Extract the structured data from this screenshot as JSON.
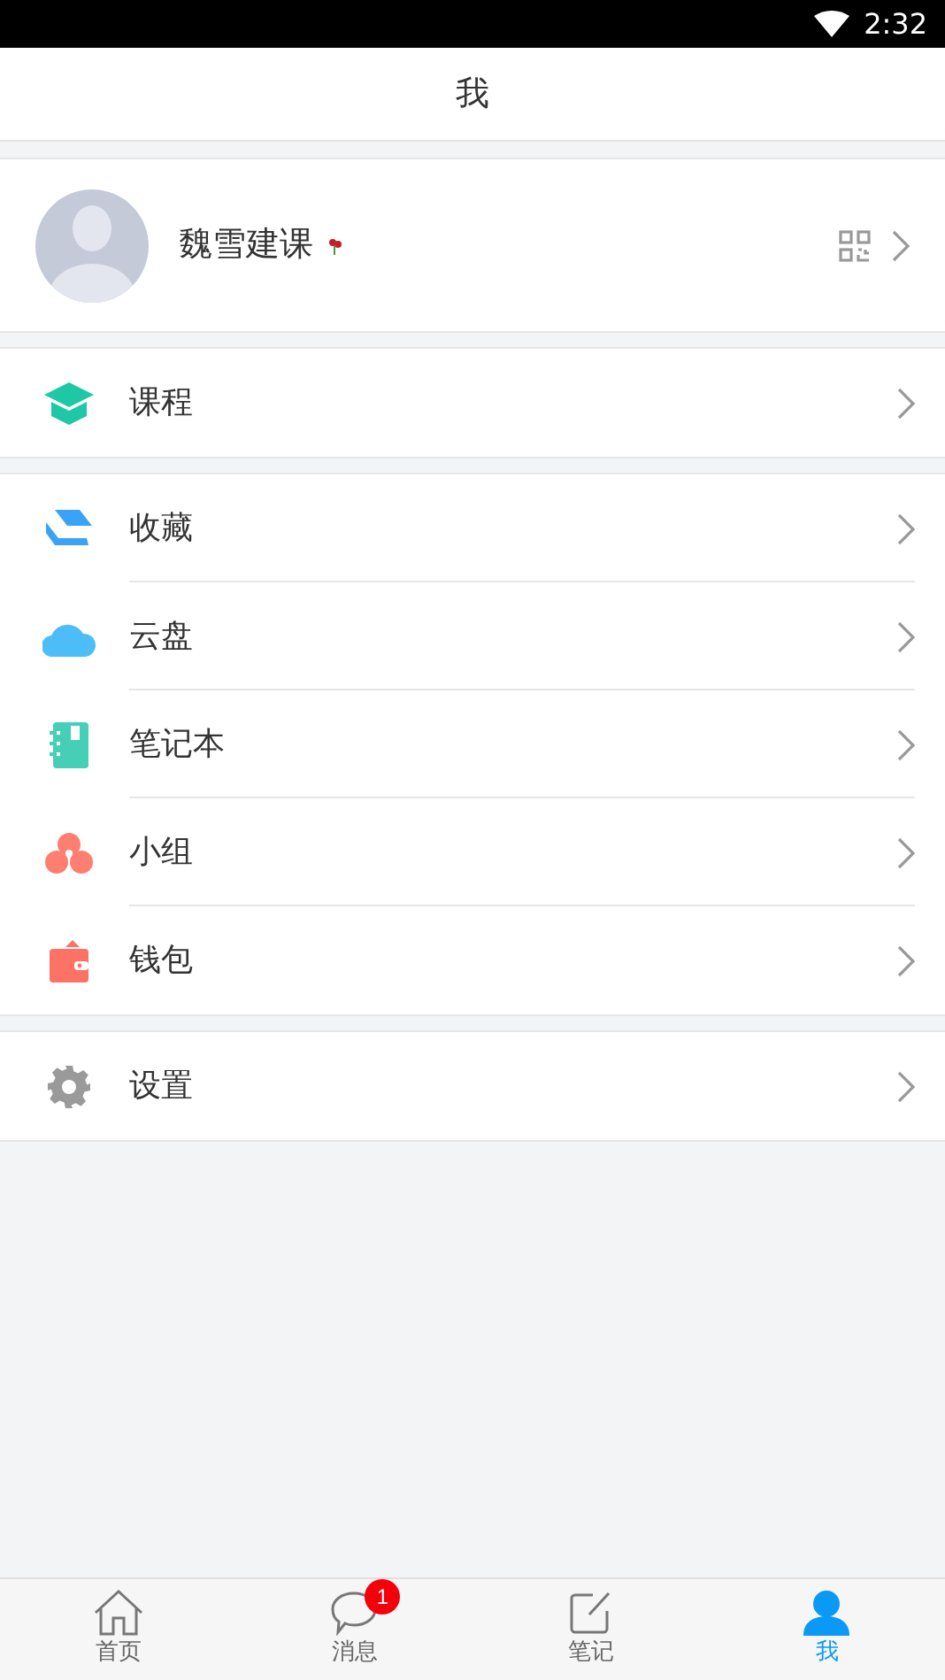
{
  "status_bar": {
    "time": "2:32"
  },
  "header": {
    "title": "我"
  },
  "profile": {
    "name": "魏雪建课"
  },
  "menu_groups": [
    [
      {
        "kind": "cap",
        "label": "课程"
      }
    ],
    [
      {
        "kind": "layers",
        "label": "收藏"
      },
      {
        "kind": "cloud",
        "label": "云盘"
      },
      {
        "kind": "notebook",
        "label": "笔记本"
      },
      {
        "kind": "circles",
        "label": "小组"
      },
      {
        "kind": "wallet",
        "label": "钱包"
      }
    ],
    [
      {
        "kind": "gear",
        "label": "设置"
      }
    ]
  ],
  "tab_bar": [
    {
      "kind": "home",
      "label": "首页",
      "selected": false
    },
    {
      "kind": "chat",
      "label": "消息",
      "selected": false,
      "badge": "1"
    },
    {
      "kind": "note",
      "label": "笔记",
      "selected": false
    },
    {
      "kind": "person",
      "label": "我",
      "selected": true
    }
  ]
}
